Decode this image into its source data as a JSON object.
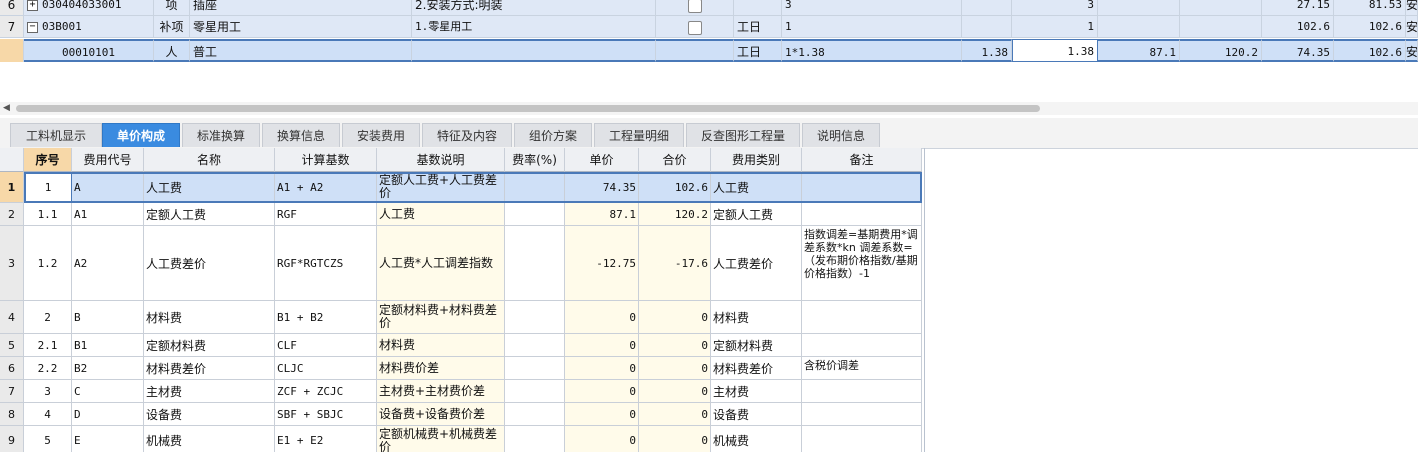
{
  "top_table": {
    "rows": [
      {
        "no": "6",
        "code": "030404033001",
        "type": "项",
        "name": "插座",
        "feature": "2.安装方式:明装",
        "unit": "",
        "qty_expr": "3",
        "qty": "3",
        "price1": "",
        "price2": "",
        "price3": "27.15",
        "price4": "81.53",
        "tail": "安"
      },
      {
        "no": "7",
        "code": "03B001",
        "type": "补项",
        "name": "零星用工",
        "feature": "1.零星用工",
        "unit": "工日",
        "qty_expr": "1",
        "qty_mid": "",
        "qty": "1",
        "price1": "",
        "price2": "",
        "price3": "102.6",
        "price4": "102.6",
        "tail": "安"
      },
      {
        "no": "",
        "code": "00010101",
        "type": "人",
        "name": "普工",
        "feature": "",
        "unit": "工日",
        "qty_expr": "1*1.38",
        "qty_mid": "1.38",
        "qty": "1.38",
        "price1": "87.1",
        "price2": "120.2",
        "price3": "74.35",
        "price4": "102.6",
        "tail": "安"
      }
    ]
  },
  "tabs": [
    {
      "label": "工料机显示",
      "active": false
    },
    {
      "label": "单价构成",
      "active": true
    },
    {
      "label": "标准换算",
      "active": false
    },
    {
      "label": "换算信息",
      "active": false
    },
    {
      "label": "安装费用",
      "active": false
    },
    {
      "label": "特征及内容",
      "active": false
    },
    {
      "label": "组价方案",
      "active": false
    },
    {
      "label": "工程量明细",
      "active": false
    },
    {
      "label": "反查图形工程量",
      "active": false
    },
    {
      "label": "说明信息",
      "active": false
    }
  ],
  "detail_table": {
    "headers": [
      "序号",
      "费用代号",
      "名称",
      "计算基数",
      "基数说明",
      "费率(%)",
      "单价",
      "合价",
      "费用类别",
      "备注"
    ],
    "rows": [
      {
        "rn": "1",
        "seq": "1",
        "code": "A",
        "name": "人工费",
        "base": "A1 + A2",
        "desc": "定额人工费+人工费差价",
        "rate": "",
        "unit_price": "74.35",
        "total": "102.6",
        "category": "人工费",
        "note": ""
      },
      {
        "rn": "2",
        "seq": "1.1",
        "code": "A1",
        "name": "定额人工费",
        "base": "RGF",
        "desc": "人工费",
        "rate": "",
        "unit_price": "87.1",
        "total": "120.2",
        "category": "定额人工费",
        "note": ""
      },
      {
        "rn": "3",
        "seq": "1.2",
        "code": "A2",
        "name": "人工费差价",
        "base": "RGF*RGTCZS",
        "desc": "人工费*人工调差指数",
        "rate": "",
        "unit_price": "-12.75",
        "total": "-17.6",
        "category": "人工费差价",
        "note": "指数调差=基期费用*调差系数*kn 调差系数=（发布期价格指数/基期价格指数）-1"
      },
      {
        "rn": "4",
        "seq": "2",
        "code": "B",
        "name": "材料费",
        "base": "B1 + B2",
        "desc": "定额材料费+材料费差价",
        "rate": "",
        "unit_price": "0",
        "total": "0",
        "category": "材料费",
        "note": ""
      },
      {
        "rn": "5",
        "seq": "2.1",
        "code": "B1",
        "name": "定额材料费",
        "base": "CLF",
        "desc": "材料费",
        "rate": "",
        "unit_price": "0",
        "total": "0",
        "category": "定额材料费",
        "note": ""
      },
      {
        "rn": "6",
        "seq": "2.2",
        "code": "B2",
        "name": "材料费差价",
        "base": "CLJC",
        "desc": "材料费价差",
        "rate": "",
        "unit_price": "0",
        "total": "0",
        "category": "材料费差价",
        "note": "含税价调差"
      },
      {
        "rn": "7",
        "seq": "3",
        "code": "C",
        "name": "主材费",
        "base": "ZCF + ZCJC",
        "desc": "主材费+主材费价差",
        "rate": "",
        "unit_price": "0",
        "total": "0",
        "category": "主材费",
        "note": ""
      },
      {
        "rn": "8",
        "seq": "4",
        "code": "D",
        "name": "设备费",
        "base": "SBF + SBJC",
        "desc": "设备费+设备费价差",
        "rate": "",
        "unit_price": "0",
        "total": "0",
        "category": "设备费",
        "note": ""
      },
      {
        "rn": "9",
        "seq": "5",
        "code": "E",
        "name": "机械费",
        "base": "E1 + E2",
        "desc": "定额机械费+机械费差价",
        "rate": "",
        "unit_price": "0",
        "total": "0",
        "category": "机械费",
        "note": ""
      }
    ]
  },
  "colors": {
    "accent": "#3a8be0",
    "selection": "#cfe0f7",
    "header_highlight": "#f7d8a8"
  }
}
